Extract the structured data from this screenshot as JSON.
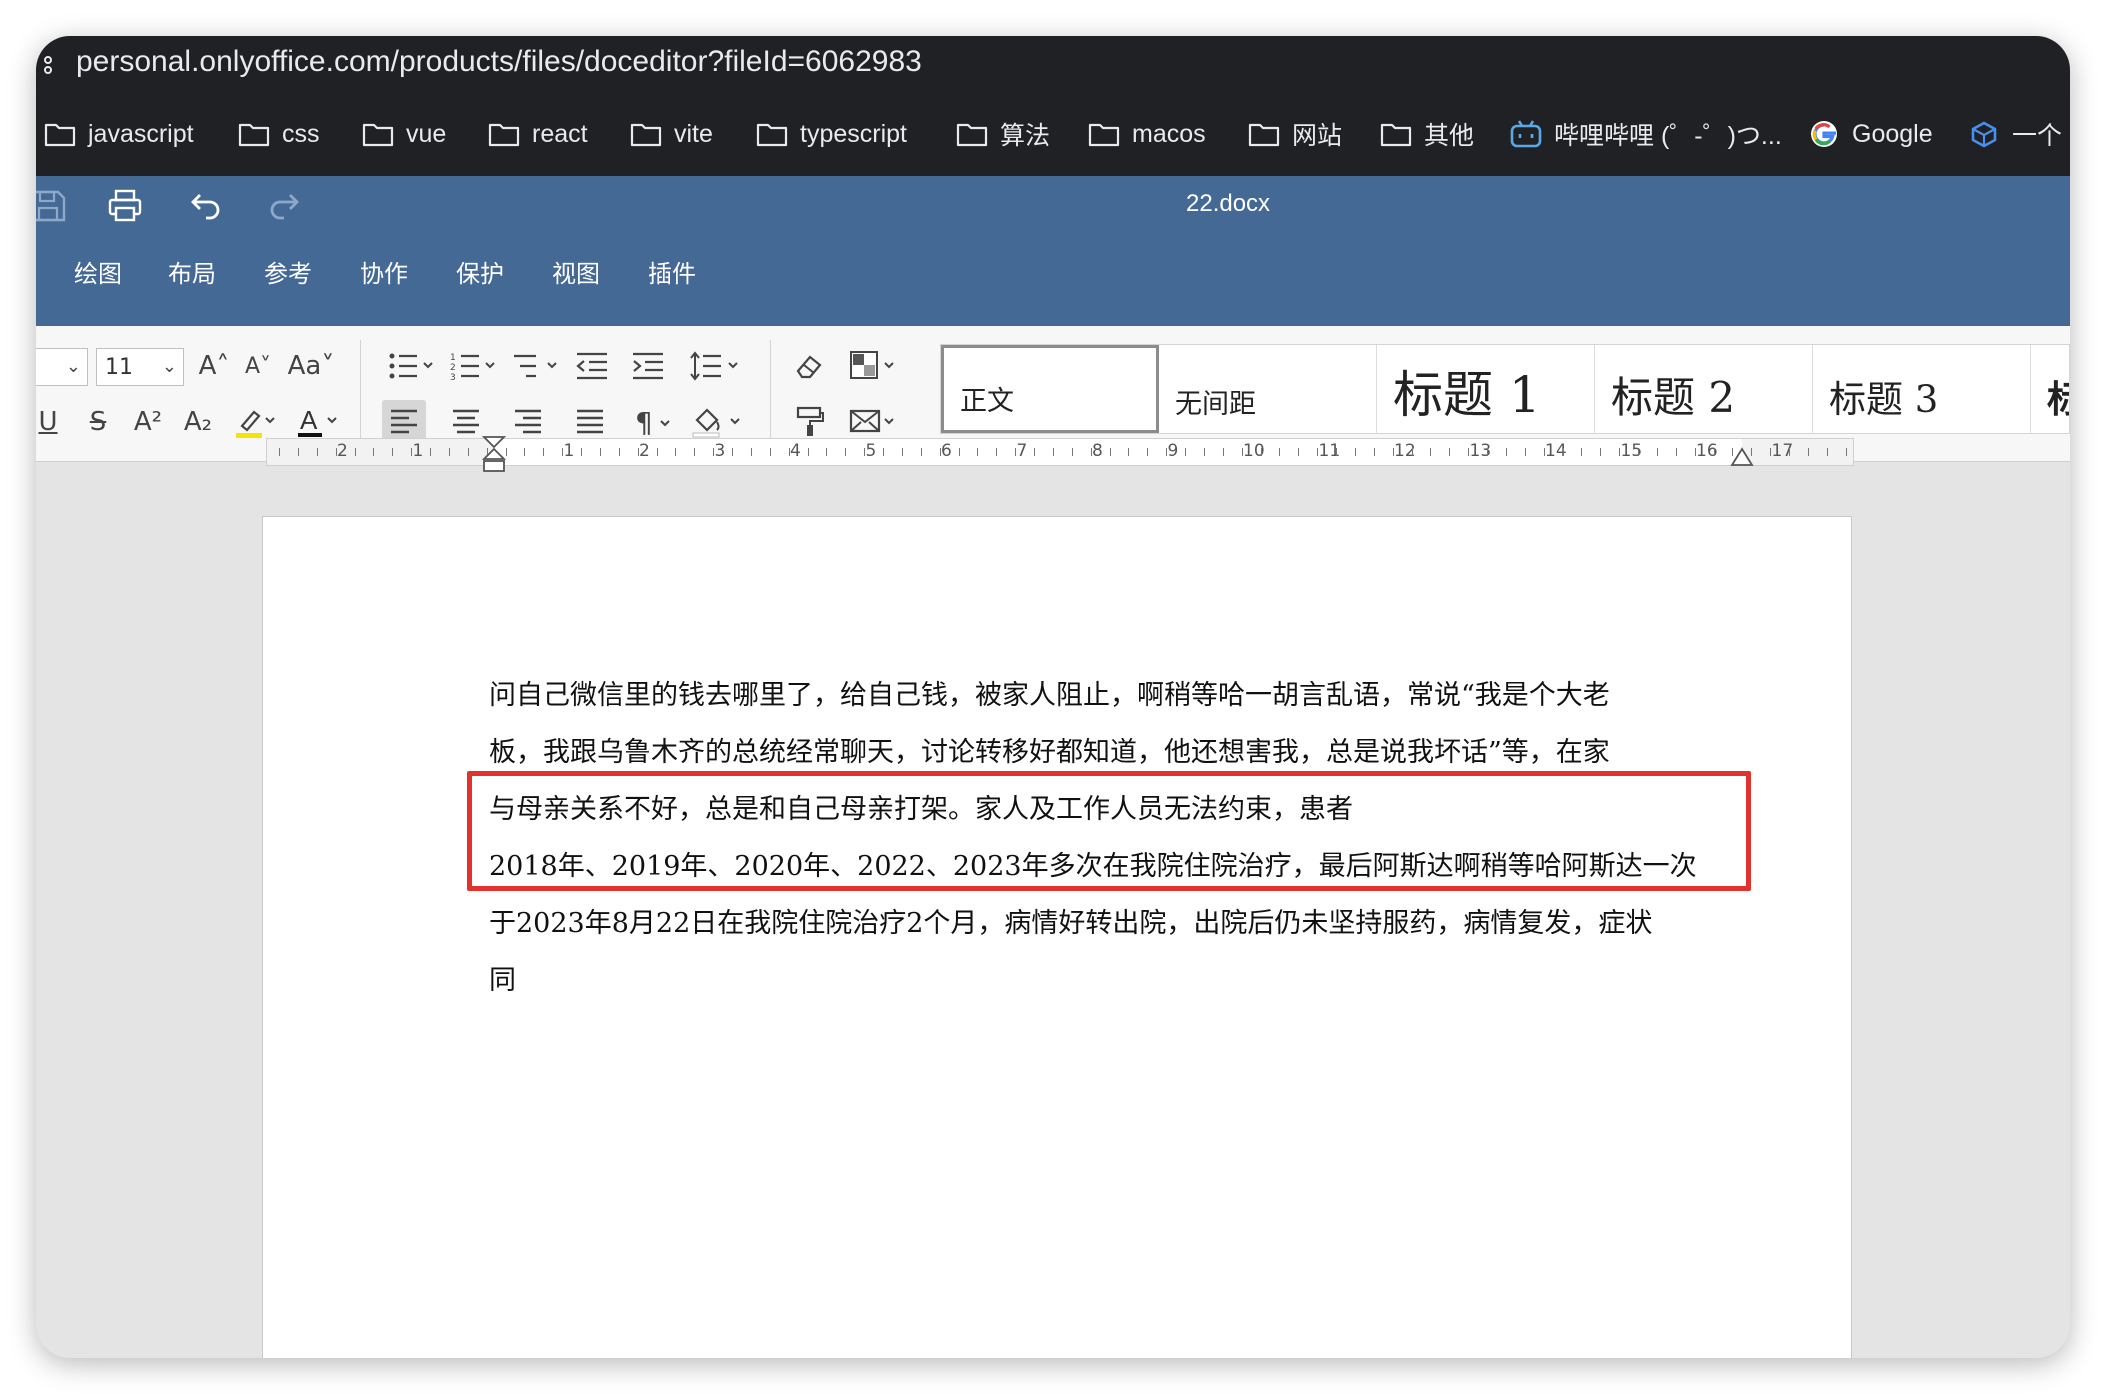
{
  "browser": {
    "url": "personal.onlyoffice.com/products/files/doceditor?fileId=6062983",
    "bookmarks": [
      {
        "label": "javascript",
        "icon": "folder-icon"
      },
      {
        "label": "css",
        "icon": "folder-icon"
      },
      {
        "label": "vue",
        "icon": "folder-icon"
      },
      {
        "label": "react",
        "icon": "folder-icon"
      },
      {
        "label": "vite",
        "icon": "folder-icon"
      },
      {
        "label": "typescript",
        "icon": "folder-icon"
      },
      {
        "label": "算法",
        "icon": "folder-icon"
      },
      {
        "label": "macos",
        "icon": "folder-icon"
      },
      {
        "label": "网站",
        "icon": "folder-icon"
      },
      {
        "label": "其他",
        "icon": "folder-icon"
      },
      {
        "label": "哔哩哔哩 (゜-゜)つ...",
        "icon": "bilibili-icon"
      },
      {
        "label": "Google",
        "icon": "google-icon"
      },
      {
        "label": "一个",
        "icon": "cube-icon"
      }
    ]
  },
  "editor": {
    "doc_title": "22.docx",
    "menu_tabs": [
      "绘图",
      "布局",
      "参考",
      "协作",
      "保护",
      "视图",
      "插件"
    ],
    "font_size": "11",
    "styles": [
      "正文",
      "无间距",
      "标题 1",
      "标题 2",
      "标题 3",
      "标"
    ],
    "ruler_numbers": [
      "2",
      "1",
      "1",
      "2",
      "3",
      "4",
      "5",
      "6",
      "7",
      "8",
      "9",
      "10",
      "11",
      "12",
      "13",
      "14",
      "15",
      "16",
      "17"
    ]
  },
  "document": {
    "lines": [
      "问自己微信里的钱去哪里了，给自己钱，被家人阻止，啊稍等哈一胡言乱语，常说“我是个大老",
      "板，我跟乌鲁木齐的总统经常聊天，讨论转移好都知道，他还想害我，总是说我坏话”等，在家",
      "与母亲关系不好，总是和自己母亲打架。家人及工作人员无法约束，患者",
      "2018年、2019年、2020年、2022、2023年多次在我院住院治疗，最后阿斯达啊稍等哈阿斯达一次",
      "于2023年8月22日在我院住院治疗2个月，病情好转出院，出院后仍未坚持服药，病情复发，症状",
      "同"
    ]
  },
  "colors": {
    "header_blue": "#446995",
    "browser_dark": "#202124",
    "highlight_red": "#e0322e"
  }
}
